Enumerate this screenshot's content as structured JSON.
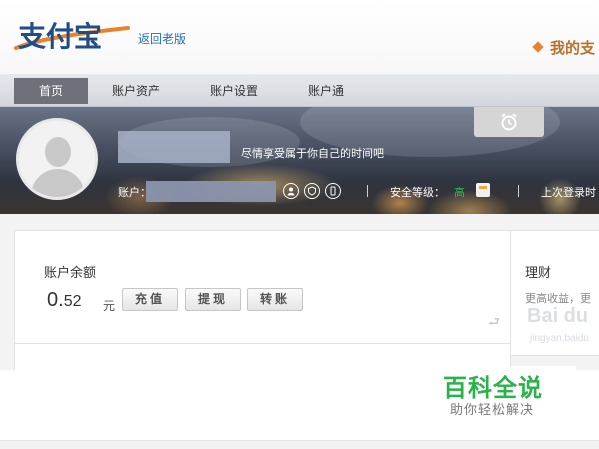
{
  "header": {
    "logo_text": "支付宝",
    "old_version_link": "返回老版",
    "mine_label": "我的支"
  },
  "nav": {
    "items": [
      {
        "label": "首页",
        "active": true
      },
      {
        "label": "账户资产",
        "active": false
      },
      {
        "label": "账户设置",
        "active": false
      },
      {
        "label": "账户通",
        "active": false
      }
    ]
  },
  "profile": {
    "slogan": "尽情享受属于你自己的时间吧",
    "account_label": "账户：",
    "security_label": "安全等级：",
    "security_level": "高",
    "last_login_label": "上次登录时",
    "icons": [
      "user-circle-icon",
      "shield-badge-icon",
      "mobile-phone-icon",
      "alarm-clock-icon",
      "security-card-icon"
    ]
  },
  "balance": {
    "title": "账户余额",
    "amount_int": "0.",
    "amount_dec": "52",
    "unit": "元",
    "buttons": {
      "recharge": "充值",
      "withdraw": "提现",
      "transfer": "转账"
    }
  },
  "finance": {
    "title": "理财",
    "subtitle": "更高收益，更"
  },
  "watermark": {
    "baidu": "Bai du",
    "jingyan": "jingyan.baidu",
    "title": "百科全说",
    "subtitle": "助你轻松解决"
  },
  "colors": {
    "brand_orange": "#e9822f",
    "link_blue": "#2a6fb0",
    "security_green": "#27c14a",
    "watermark_green": "#2bb24c",
    "nav_active": "#6e7179"
  }
}
